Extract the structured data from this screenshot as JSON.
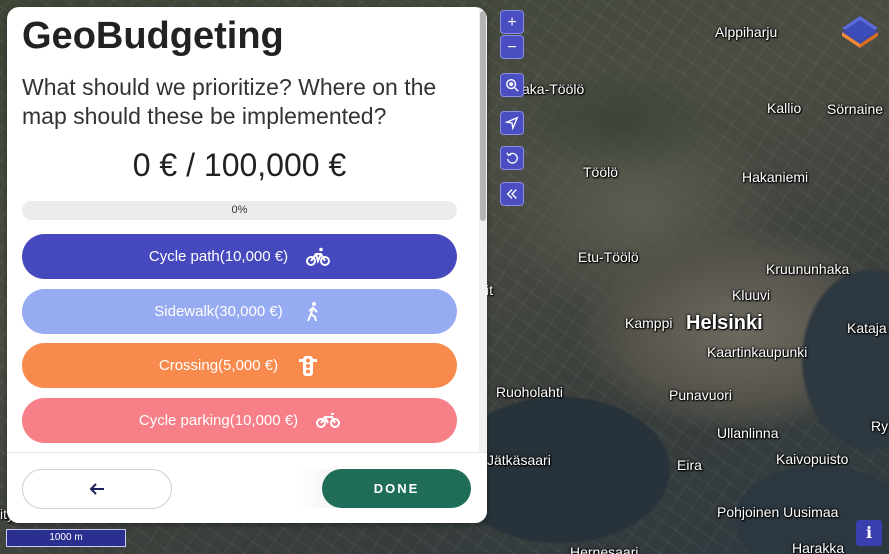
{
  "app": {
    "title": "GeoBudgeting",
    "question": "What should we prioritize? Where on the map should these be implemented?",
    "budget_text": "0 € / 100,000 €",
    "progress": {
      "value": 0,
      "label": "0%"
    }
  },
  "options": [
    {
      "label": "Cycle path(10,000 €)",
      "icon": "bicycle-icon",
      "color": "#4649bd"
    },
    {
      "label": "Sidewalk(30,000 €)",
      "icon": "pedestrian-icon",
      "color": "#97abf2"
    },
    {
      "label": "Crossing(5,000 €)",
      "icon": "traffic-light-icon",
      "color": "#f98a4d"
    },
    {
      "label": "Cycle parking(10,000 €)",
      "icon": "bicycle-parking-icon",
      "color": "#f77f87"
    }
  ],
  "footer": {
    "back_icon": "arrow-left-icon",
    "done_label": "DONE",
    "done_color": "#1f6d58"
  },
  "map": {
    "places": [
      "Alppiharju",
      "aka-Töölö",
      "Kallio",
      "Sörnaine",
      "Töölö",
      "Hakaniemi",
      "Etu-Töölö",
      "Kruununhaka",
      "Kluuvi",
      "Kamppi",
      "Helsinki",
      "Kataja",
      "Kaartinkaupunki",
      "Ruoholahti",
      "Punavuori",
      "Ullanlinna",
      "Ry",
      "Jätkäsaari",
      "Eira",
      "Kaivopuisto",
      "Pohjoinen Uusimaa",
      "Harakka",
      "Hernesaari",
      "it",
      "ity"
    ],
    "controls": [
      "zoom-in-icon",
      "zoom-out-icon",
      "search-location-icon",
      "locate-icon",
      "reset-icon",
      "collapse-icon"
    ],
    "zoom_in_label": "+",
    "zoom_out_label": "−",
    "scale_label": "1000 m",
    "info_label": "i",
    "accent": "#4a4ec0"
  }
}
